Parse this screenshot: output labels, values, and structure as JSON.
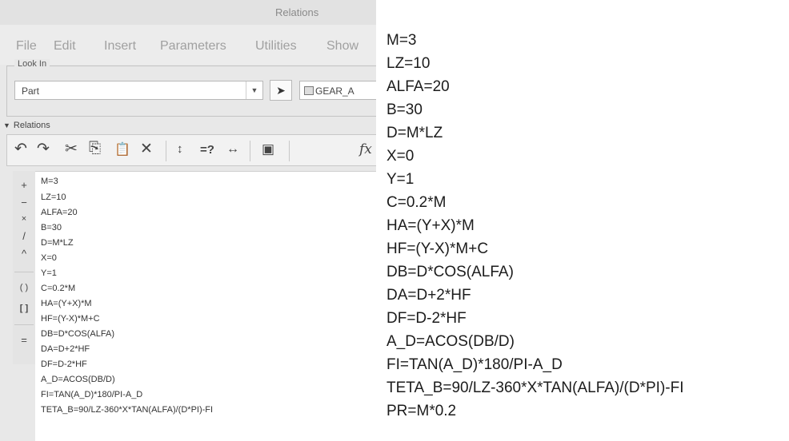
{
  "window": {
    "title": "Relations"
  },
  "menu": [
    "File",
    "Edit",
    "Insert",
    "Parameters",
    "Utilities",
    "Show"
  ],
  "look_in": {
    "label": "Look In",
    "type_value": "Part",
    "model_name": "GEAR_A"
  },
  "relations_section": {
    "label": "Relations"
  },
  "toolbar": {
    "undo": "↶",
    "redo": "↷",
    "cut": "✂",
    "copy": "⎘",
    "paste": "📋",
    "delete": "✕",
    "sort": "↕",
    "verify": "=?",
    "units": "↔",
    "evaluate": "▣",
    "insert_function": "fx"
  },
  "operators": [
    "+",
    "−",
    "×",
    "/",
    "^",
    "( )",
    "[ ]",
    "="
  ],
  "relations": [
    "M=3",
    "LZ=10",
    "ALFA=20",
    "B=30",
    "D=M*LZ",
    "X=0",
    "Y=1",
    "C=0.2*M",
    "HA=(Y+X)*M",
    "HF=(Y-X)*M+C",
    "DB=D*COS(ALFA)",
    "DA=D+2*HF",
    "DF=D-2*HF",
    "A_D=ACOS(DB/D)",
    "FI=TAN(A_D)*180/PI-A_D",
    "TETA_B=90/LZ-360*X*TAN(ALFA)/(D*PI)-FI"
  ],
  "big_relations": [
    "M=3",
    "LZ=10",
    "ALFA=20",
    "B=30",
    "D=M*LZ",
    "X=0",
    "Y=1",
    "C=0.2*M",
    "HA=(Y+X)*M",
    "HF=(Y-X)*M+C",
    "DB=D*COS(ALFA)",
    "DA=D+2*HF",
    "DF=D-2*HF",
    "A_D=ACOS(DB/D)",
    "FI=TAN(A_D)*180/PI-A_D",
    "TETA_B=90/LZ-360*X*TAN(ALFA)/(D*PI)-FI",
    "PR=M*0.2"
  ]
}
